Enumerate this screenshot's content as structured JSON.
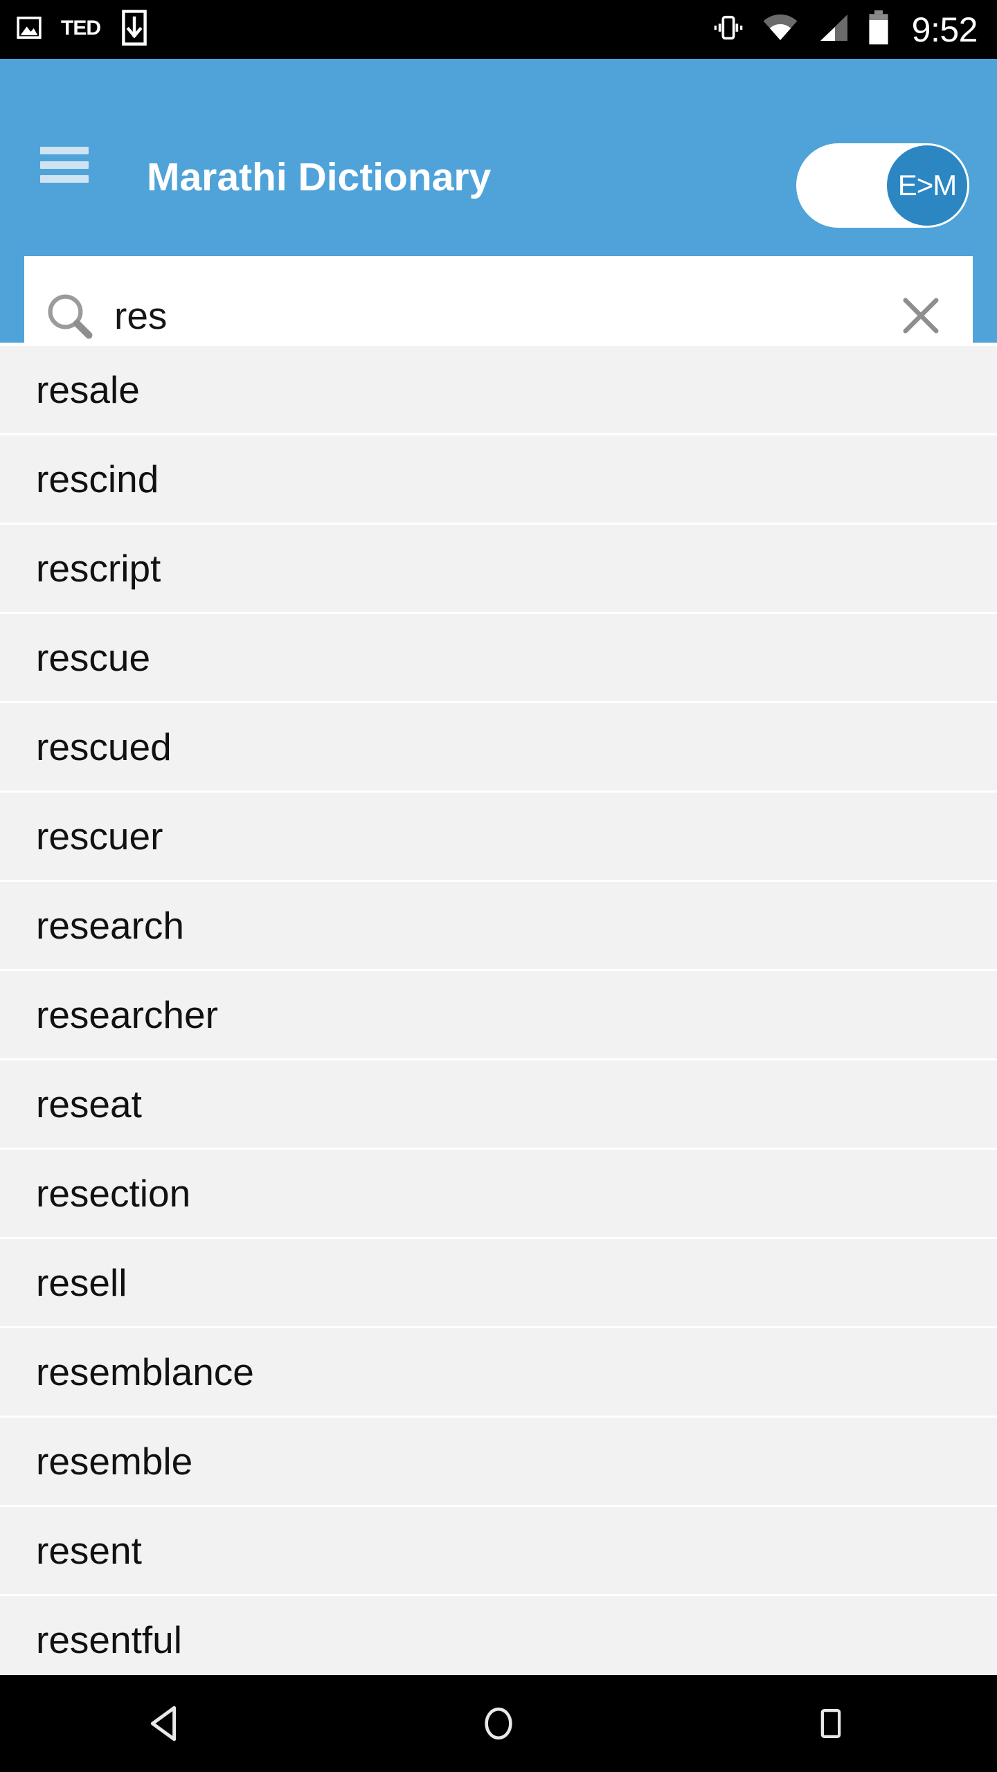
{
  "statusbar": {
    "time": "9:52",
    "left_icons": [
      {
        "name": "image-icon",
        "glyph": "photo"
      },
      {
        "name": "ted-app-icon",
        "glyph": "TED"
      },
      {
        "name": "download-icon",
        "glyph": "download"
      }
    ],
    "right_icons": [
      {
        "name": "vibrate-icon"
      },
      {
        "name": "wifi-icon"
      },
      {
        "name": "cell-signal-icon"
      },
      {
        "name": "battery-icon"
      }
    ]
  },
  "appbar": {
    "title": "Marathi Dictionary",
    "menu_label": "menu",
    "background_color": "#4fa3d8",
    "toggle": {
      "label": "E>M",
      "state": "on",
      "thumb_color": "#2b86c2",
      "track_color": "#ffffff"
    }
  },
  "search": {
    "value": "res",
    "placeholder": "Search",
    "clear_label": "Clear search",
    "icon": "search-icon"
  },
  "results": {
    "items": [
      {
        "word": "resale"
      },
      {
        "word": "rescind"
      },
      {
        "word": "rescript"
      },
      {
        "word": "rescue"
      },
      {
        "word": "rescued"
      },
      {
        "word": "rescuer"
      },
      {
        "word": "research"
      },
      {
        "word": "researcher"
      },
      {
        "word": "reseat"
      },
      {
        "word": "resection"
      },
      {
        "word": "resell"
      },
      {
        "word": "resemblance"
      },
      {
        "word": "resemble"
      },
      {
        "word": "resent"
      },
      {
        "word": "resentful"
      }
    ]
  },
  "navbar": {
    "back_label": "Back",
    "home_label": "Home",
    "recents_label": "Recent apps"
  }
}
